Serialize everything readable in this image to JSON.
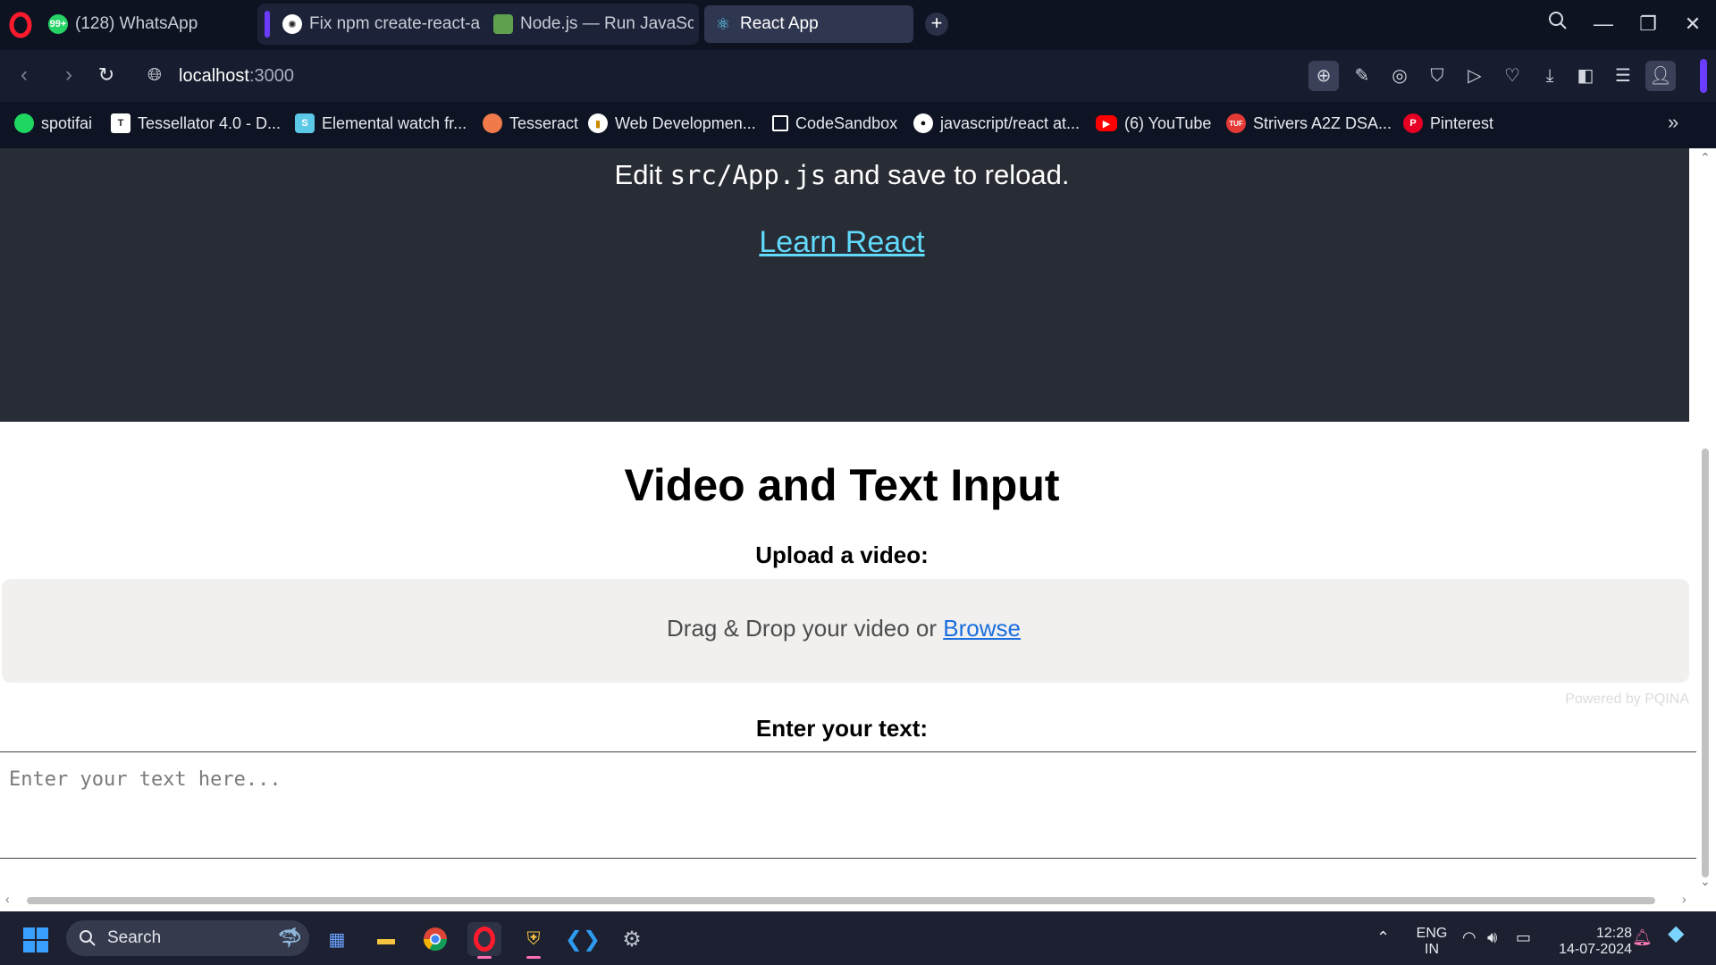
{
  "tabs": [
    {
      "title": "(128) WhatsApp",
      "icon": "whatsapp-icon",
      "badge": "99+"
    },
    {
      "title": "Fix npm create-react-ap",
      "icon": "chatgpt-icon"
    },
    {
      "title": "Node.js — Run JavaScrip",
      "icon": "nodejs-icon"
    },
    {
      "title": "React App",
      "icon": "react-icon",
      "active": true
    }
  ],
  "address": {
    "host": "localhost",
    "port": ":3000"
  },
  "bookmarks": [
    {
      "label": "spotifai",
      "icon": "spotify-icon",
      "color": "#1ed760"
    },
    {
      "label": "Tessellator 4.0 - D...",
      "icon": "tessellator-icon",
      "color": "#ffffff"
    },
    {
      "label": "Elemental watch fr...",
      "icon": "elemental-icon",
      "color": "#5cc8e8"
    },
    {
      "label": "Tesseract",
      "icon": "tesseract-icon",
      "color": "#f07a4a"
    },
    {
      "label": "Web Developmen...",
      "icon": "webdev-icon",
      "color": "#f2c94c"
    },
    {
      "label": "CodeSandbox",
      "icon": "codesandbox-icon",
      "color": "#ffffff"
    },
    {
      "label": "javascript/react at...",
      "icon": "github-icon",
      "color": "#ffffff"
    },
    {
      "label": "(6) YouTube",
      "icon": "youtube-icon",
      "color": "#ff0000"
    },
    {
      "label": "Strivers A2Z DSA...",
      "icon": "tuf-icon",
      "color": "#e53935"
    },
    {
      "label": "Pinterest",
      "icon": "pinterest-icon",
      "color": "#e60023"
    }
  ],
  "page": {
    "edit_prefix": "Edit ",
    "edit_code": "src/App.js",
    "edit_suffix": " and save to reload.",
    "learn_link": "Learn React",
    "title": "Video and Text Input",
    "upload_label": "Upload a video:",
    "drop_text": "Drag & Drop your video or ",
    "drop_browse": "Browse",
    "powered_by": "Powered by PQINA",
    "text_label": "Enter your text:",
    "text_placeholder": "Enter your text here..."
  },
  "taskbar": {
    "search_label": "Search",
    "lang_top": "ENG",
    "lang_bottom": "IN",
    "time": "12:28",
    "date": "14-07-2024"
  },
  "colors": {
    "react_header_bg": "#282c34",
    "react_link": "#61dafb",
    "browse_link": "#1a6ee0",
    "opera_red": "#ff1b2d",
    "accent_purple": "#6b3cff"
  }
}
